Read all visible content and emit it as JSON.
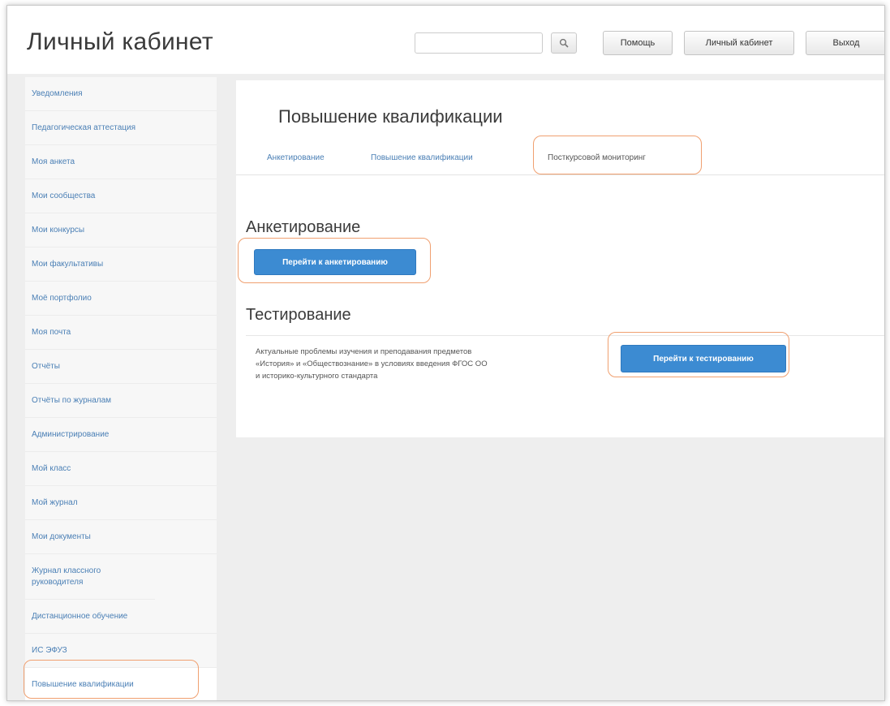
{
  "header": {
    "title": "Личный кабинет",
    "search": {
      "value": "",
      "placeholder": ""
    },
    "search_icon": "search-icon",
    "buttons": {
      "help": "Помощь",
      "cabinet": "Личный кабинет",
      "logout": "Выход"
    }
  },
  "sidebar": {
    "items": [
      "Уведомления",
      "Педагогическая аттестация",
      "Моя анкета",
      "Мои сообщества",
      "Мои конкурсы",
      "Мои факультативы",
      "Моё портфолио",
      "Моя почта",
      "Отчёты",
      "Отчёты по журналам",
      "Администрирование",
      "Мой класс",
      "Мой журнал",
      "Мои документы",
      "Журнал классного руководителя",
      "Дистанционное обучение",
      "ИС ЭФУЗ",
      "Повышение квалификации"
    ]
  },
  "main": {
    "title": "Повышение квалификации",
    "tabs": [
      "Анкетирование",
      "Повышение квалификации",
      "Посткурсовой мониторинг"
    ],
    "survey": {
      "title": "Анкетирование",
      "button": "Перейти к анкетированию"
    },
    "testing": {
      "title": "Тестирование",
      "description_lines": [
        "Актуальные проблемы изучения и преподавания предметов",
        "«История» и «Обществознание» в условиях введения ФГОС ОО",
        "и историко-культурного стандарта"
      ],
      "button": "Перейти к тестированию"
    }
  },
  "colors": {
    "accent": "#3c8bd2",
    "link": "#4a7fb5",
    "annotation": "#f0a070"
  }
}
